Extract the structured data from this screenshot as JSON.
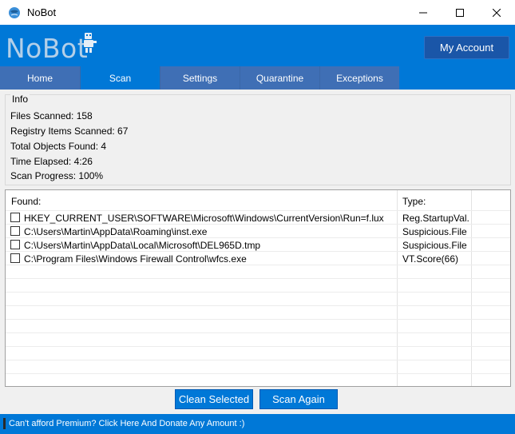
{
  "window": {
    "title": "NoBot",
    "icon": "nobot-globe-icon"
  },
  "header": {
    "logo_text": "NoBot",
    "account_label": "My Account"
  },
  "tabs": [
    {
      "label": "Home",
      "active": false
    },
    {
      "label": "Scan",
      "active": true
    },
    {
      "label": "Settings",
      "active": false
    },
    {
      "label": "Quarantine",
      "active": false
    },
    {
      "label": "Exceptions",
      "active": false
    }
  ],
  "info": {
    "legend": "Info",
    "files_scanned": "Files Scanned: 158",
    "registry_items": "Registry Items Scanned: 67",
    "total_objects": "Total Objects Found: 4",
    "time_elapsed": "Time Elapsed: 4:26",
    "scan_progress": "Scan Progress: 100%"
  },
  "results": {
    "col_found": "Found:",
    "col_type": "Type:",
    "rows": [
      {
        "path": "HKEY_CURRENT_USER\\SOFTWARE\\Microsoft\\Windows\\CurrentVersion\\Run=f.lux",
        "type": "Reg.StartupVal...",
        "checked": false
      },
      {
        "path": "C:\\Users\\Martin\\AppData\\Roaming\\inst.exe",
        "type": "Suspicious.File",
        "checked": false
      },
      {
        "path": "C:\\Users\\Martin\\AppData\\Local\\Microsoft\\DEL965D.tmp",
        "type": "Suspicious.File",
        "checked": false
      },
      {
        "path": "C:\\Program Files\\Windows Firewall Control\\wfcs.exe",
        "type": "VT.Score(66)",
        "checked": false
      }
    ]
  },
  "actions": {
    "clean_label": "Clean Selected",
    "scan_again_label": "Scan Again"
  },
  "status": {
    "text": "Can't afford Premium? Click Here And Donate Any Amount :)"
  },
  "colors": {
    "accent": "#0078d7",
    "tab_inactive": "#3f6fb5",
    "account_button": "#1a56a8"
  }
}
